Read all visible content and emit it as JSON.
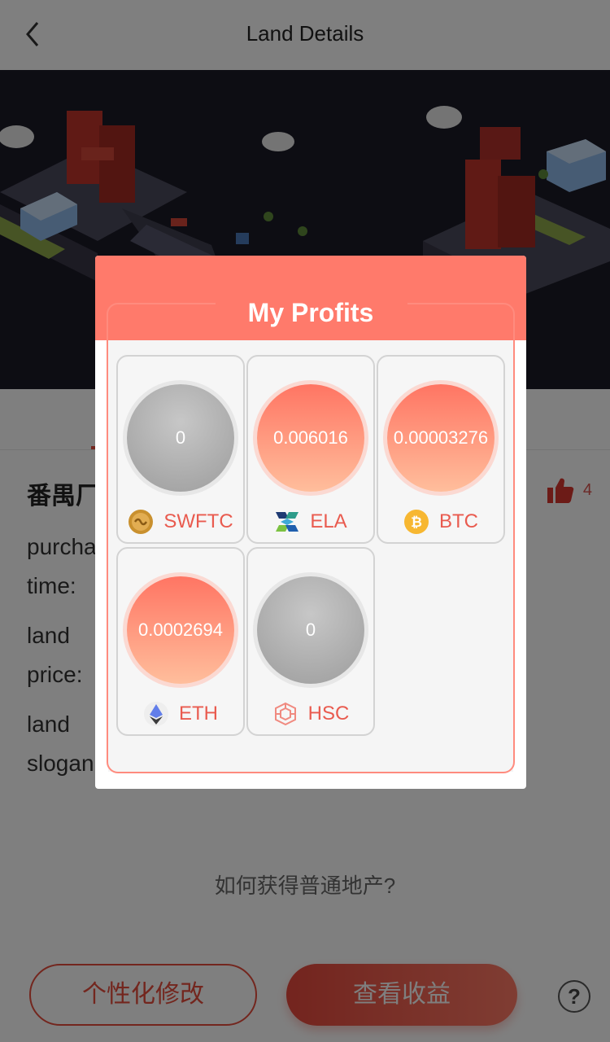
{
  "header": {
    "title": "Land Details"
  },
  "page": {
    "land_name": "番禺厂",
    "like_count": "4",
    "purchase_label_line1": "purcha",
    "purchase_label_line2": "time:",
    "price_label_line1": "land",
    "price_label_line2": "price:",
    "slogan_label_line1": "land",
    "slogan_label_line2": "slogan",
    "help_link": "如何获得普通地产?",
    "customize_button": "个性化修改",
    "earnings_button": "查看收益",
    "help_button": "?"
  },
  "modal": {
    "title": "My Profits",
    "coins": [
      {
        "name": "SWFTC",
        "value": "0",
        "icon": "swftc-coin-icon",
        "style": "gray"
      },
      {
        "name": "ELA",
        "value": "0.006016",
        "icon": "ela-coin-icon",
        "style": "orange"
      },
      {
        "name": "BTC",
        "value": "0.00003276",
        "icon": "btc-coin-icon",
        "style": "orange"
      },
      {
        "name": "ETH",
        "value": "0.0002694",
        "icon": "eth-coin-icon",
        "style": "orange"
      },
      {
        "name": "HSC",
        "value": "0",
        "icon": "hsc-coin-icon",
        "style": "gray"
      }
    ]
  },
  "colors": {
    "accent": "#e74c3c",
    "modal_header": "#ff7a6b",
    "coin_label": "#e95b4f"
  }
}
